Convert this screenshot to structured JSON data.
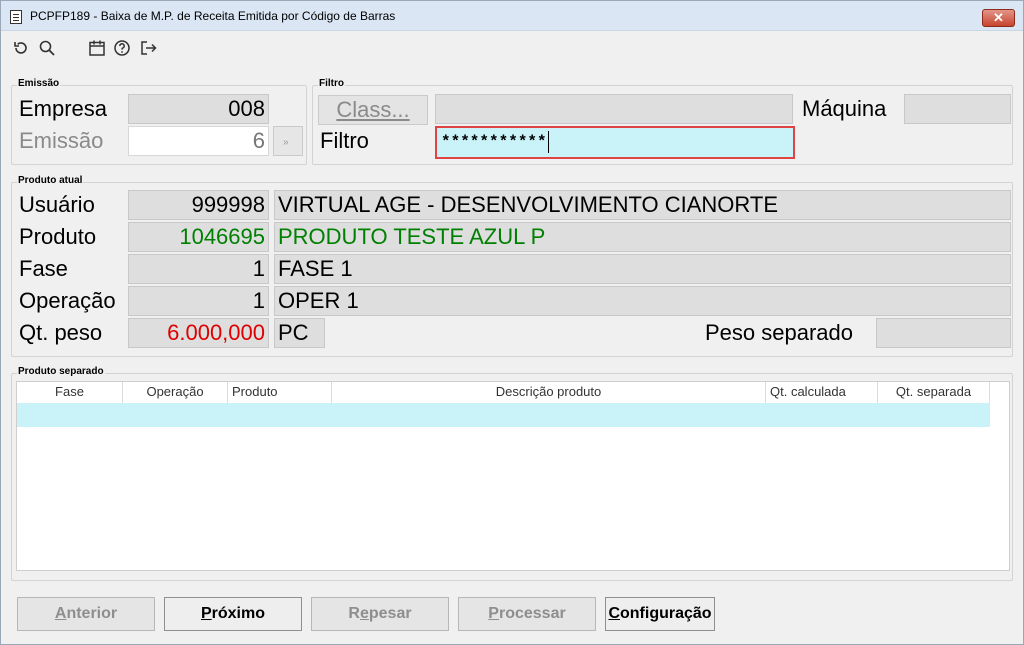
{
  "window": {
    "title": "PCPFP189 - Baixa de M.P. de Receita Emitida por Código de Barras",
    "close": "✕"
  },
  "toolbar": {
    "icons": [
      "undo-icon",
      "search-icon",
      "calendar-icon",
      "help-icon",
      "exit-icon"
    ]
  },
  "emissao": {
    "legend": "Emissão",
    "empresa_label": "Empresa",
    "empresa_value": "008",
    "emissao_label": "Emissão",
    "emissao_value": "6",
    "lookup_glyph": "»"
  },
  "filtro": {
    "legend": "Filtro",
    "class_button": "Class...",
    "class_value": "",
    "maquina_label": "Máquina",
    "maquina_value": "",
    "filtro_label": "Filtro",
    "filtro_value": "***********"
  },
  "produto_atual": {
    "legend": "Produto atual",
    "usuario_label": "Usuário",
    "usuario_code": "999998",
    "usuario_desc": "VIRTUAL AGE - DESENVOLVIMENTO CIANORTE",
    "produto_label": "Produto",
    "produto_code": "1046695",
    "produto_desc": "PRODUTO TESTE AZUL P",
    "fase_label": "Fase",
    "fase_code": "1",
    "fase_desc": "FASE 1",
    "operacao_label": "Operação",
    "operacao_code": "1",
    "operacao_desc": "OPER 1",
    "qt_peso_label": "Qt. peso",
    "qt_peso_value": "6.000,000",
    "unit": "PC",
    "peso_separado_label": "Peso separado",
    "peso_separado_value": "",
    "colors": {
      "produto": "#008000",
      "qt_peso": "#e00000"
    }
  },
  "produto_separado": {
    "legend": "Produto separado",
    "columns": [
      "Fase",
      "Operação",
      "Produto",
      "Descrição produto",
      "Qt. calculada",
      "Qt. separada"
    ],
    "selection_color": "#c9f2f9"
  },
  "buttons": {
    "anterior": {
      "mnemonic": "A",
      "rest": "nterior"
    },
    "proximo": {
      "mnemonic": "P",
      "rest": "róximo"
    },
    "repesar_pre": "R",
    "repesar_mn": "e",
    "repesar_rest": "pesar",
    "processar": {
      "mnemonic": "P",
      "rest": "rocessar"
    },
    "configuracao": {
      "mnemonic": "C",
      "rest": "onfiguração"
    }
  }
}
